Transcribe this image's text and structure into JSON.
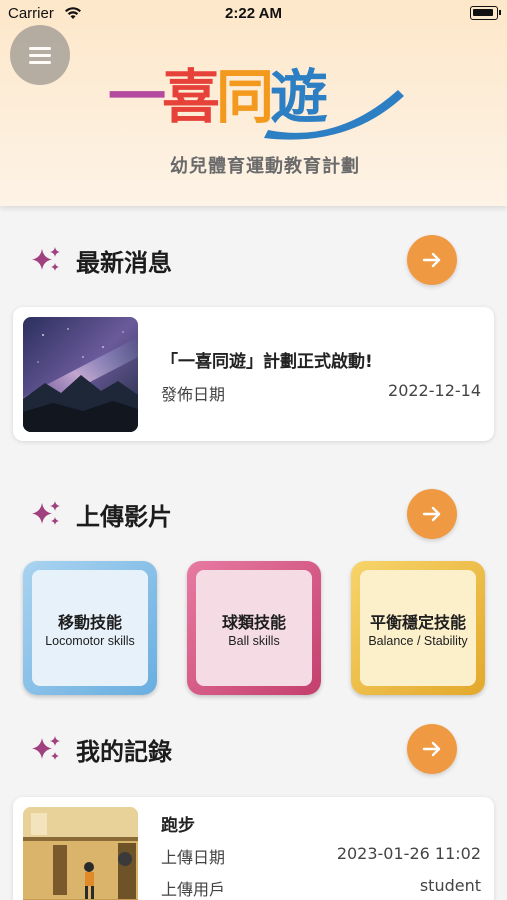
{
  "status_bar": {
    "carrier": "Carrier",
    "time": "2:22 AM"
  },
  "app": {
    "logo_text": [
      "一",
      "喜",
      "同",
      "遊"
    ],
    "subtitle": "幼兒體育運動教育計劃"
  },
  "sections": {
    "news": {
      "title": "最新消息"
    },
    "upload": {
      "title": "上傳影片"
    },
    "records": {
      "title": "我的記錄"
    }
  },
  "news_card": {
    "title": "「一喜同遊」計劃正式啟動!",
    "date_label": "發佈日期",
    "date_value": "2022-12-14"
  },
  "skills": [
    {
      "zh": "移動技能",
      "en": "Locomotor skills"
    },
    {
      "zh": "球類技能",
      "en": "Ball skills"
    },
    {
      "zh": "平衡穩定技能",
      "en": "Balance / Stability"
    }
  ],
  "record_card": {
    "title": "跑步",
    "date_label": "上傳日期",
    "date_value": "2023-01-26 11:02",
    "user_label": "上傳用戶",
    "user_value": "student"
  },
  "colors": {
    "accent_orange": "#ef9a42",
    "sparkle_purple": "#a0407f",
    "locomotor_blue": "#69aee0",
    "ball_pink": "#c43f6d",
    "balance_yellow": "#e3a82b"
  },
  "icons": {
    "menu": "hamburger-menu-icon",
    "section": "sparkle-icon",
    "more": "arrow-right-icon"
  }
}
